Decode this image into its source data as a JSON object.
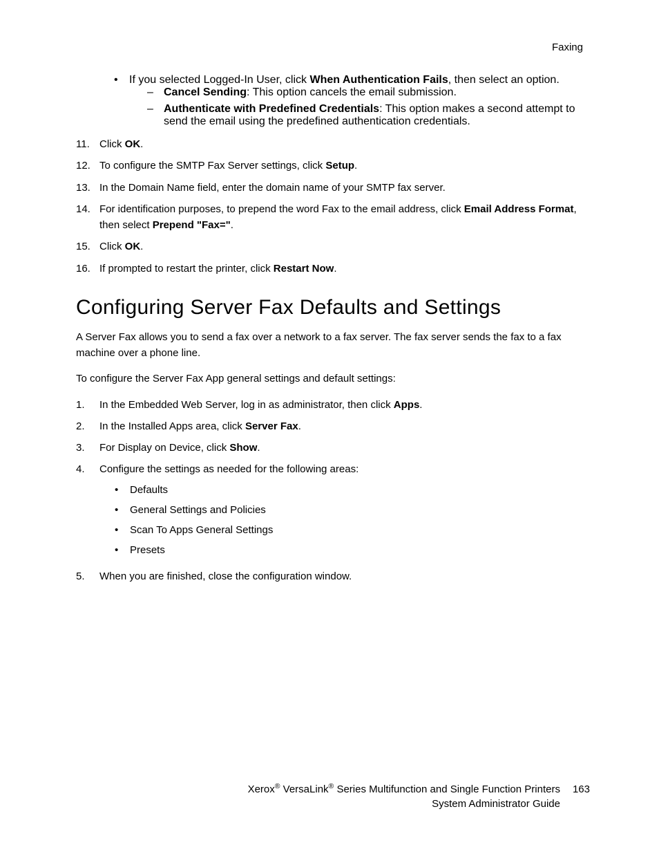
{
  "header": {
    "section": "Faxing"
  },
  "top_list": {
    "bullet_intro": {
      "pre": "If you selected Logged-In User, click ",
      "bold": "When Authentication Fails",
      "post": ", then select an option."
    },
    "dash1": {
      "bold": "Cancel Sending",
      "post": ": This option cancels the email submission."
    },
    "dash2": {
      "bold": "Authenticate with Predefined Credentials",
      "post": ": This option makes a second attempt to send the email using the predefined authentication credentials."
    },
    "s11": {
      "num": "11.",
      "pre": "Click ",
      "bold": "OK",
      "post": "."
    },
    "s12": {
      "num": "12.",
      "pre": "To configure the SMTP Fax Server settings, click ",
      "bold": "Setup",
      "post": "."
    },
    "s13": {
      "num": "13.",
      "text": "In the Domain Name field, enter the domain name of your SMTP fax server."
    },
    "s14": {
      "num": "14.",
      "pre": "For identification purposes, to prepend the word Fax to the email address, click ",
      "bold1": "Email Address Format",
      "mid": ", then select ",
      "bold2": "Prepend \"Fax=\"",
      "post": "."
    },
    "s15": {
      "num": "15.",
      "pre": "Click ",
      "bold": "OK",
      "post": "."
    },
    "s16": {
      "num": "16.",
      "pre": "If prompted to restart the printer, click ",
      "bold": "Restart Now",
      "post": "."
    }
  },
  "heading": "Configuring Server Fax Defaults and Settings",
  "para1": "A Server Fax allows you to send a fax over a network to a fax server. The fax server sends the fax to a fax machine over a phone line.",
  "para2": "To configure the Server Fax App general settings and default settings:",
  "steps": {
    "s1": {
      "num": "1.",
      "pre": "In the Embedded Web Server, log in as administrator, then click ",
      "bold": "Apps",
      "post": "."
    },
    "s2": {
      "num": "2.",
      "pre": "In the Installed Apps area, click ",
      "bold": "Server Fax",
      "post": "."
    },
    "s3": {
      "num": "3.",
      "pre": "For Display on Device, click ",
      "bold": "Show",
      "post": "."
    },
    "s4": {
      "num": "4.",
      "text": "Configure the settings as needed for the following areas:",
      "bullets": [
        "Defaults",
        "General Settings and Policies",
        "Scan To Apps General Settings",
        "Presets"
      ]
    },
    "s5": {
      "num": "5.",
      "text": "When you are finished, close the configuration window."
    }
  },
  "footer": {
    "line1a": "Xerox",
    "line1b": " VersaLink",
    "line1c": " Series Multifunction and Single Function Printers",
    "line2": "System Administrator Guide",
    "page": "163"
  }
}
